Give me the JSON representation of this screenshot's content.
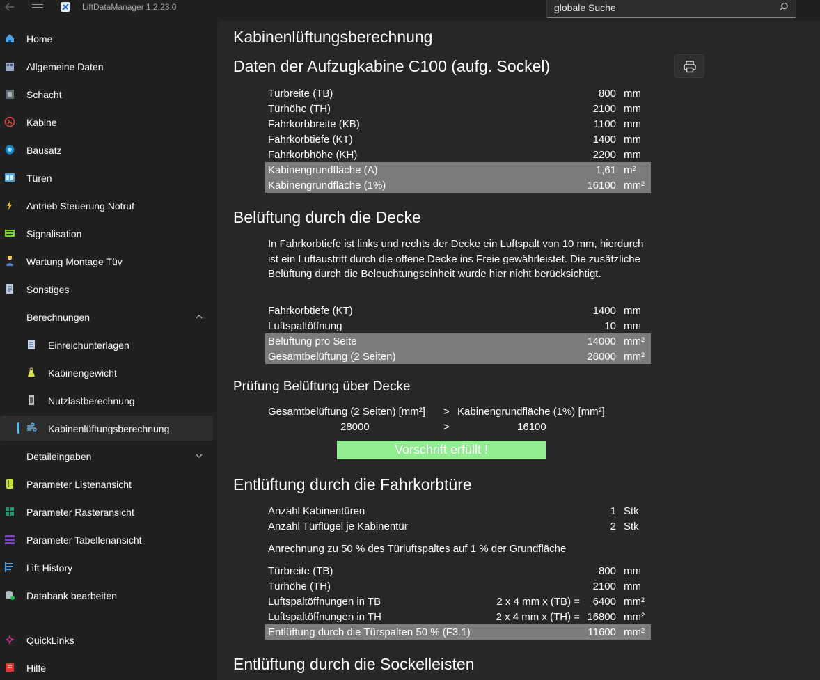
{
  "app": {
    "title": "LiftDataManager  1.2.23.0",
    "search_placeholder": "globale Suche"
  },
  "colors": {
    "accent": "#4cc2ff",
    "highlight_row": "#7c7c7c",
    "success": "#90ee90",
    "content_bg": "#272727",
    "window_bg": "#202020"
  },
  "sidebar": {
    "items": [
      {
        "label": "Home",
        "icon": "home-icon"
      },
      {
        "label": "Allgemeine Daten",
        "icon": "building-icon"
      },
      {
        "label": "Schacht",
        "icon": "shaft-icon"
      },
      {
        "label": "Kabine",
        "icon": "cabin-icon"
      },
      {
        "label": "Bausatz",
        "icon": "kit-icon"
      },
      {
        "label": "Türen",
        "icon": "door-icon"
      },
      {
        "label": "Antrieb Steuerung Notruf",
        "icon": "lightning-icon"
      },
      {
        "label": "Signalisation",
        "icon": "signal-panel-icon"
      },
      {
        "label": "Wartung Montage Tüv",
        "icon": "worker-icon"
      },
      {
        "label": "Sonstiges",
        "icon": "document-icon"
      },
      {
        "label": "Berechnungen",
        "icon": "",
        "expanded": true
      },
      {
        "label": "Einreichunterlagen",
        "icon": "submission-icon",
        "sub": true
      },
      {
        "label": "Kabinengewicht",
        "icon": "weight-icon",
        "sub": true
      },
      {
        "label": "Nutzlastberechnung",
        "icon": "payload-icon",
        "sub": true
      },
      {
        "label": "Kabinenlüftungsberechnung",
        "icon": "ventilation-icon",
        "sub": true,
        "active": true
      },
      {
        "label": "Detaileingaben",
        "icon": "",
        "expanded": false
      },
      {
        "label": "Parameter Listenansicht",
        "icon": "list-view-icon"
      },
      {
        "label": "Parameter Rasteransicht",
        "icon": "grid-view-icon"
      },
      {
        "label": "Parameter Tabellenansicht",
        "icon": "table-view-icon"
      },
      {
        "label": "Lift History",
        "icon": "history-icon"
      },
      {
        "label": "Databank bearbeiten",
        "icon": "database-edit-icon"
      },
      {
        "label": "QuickLinks",
        "icon": "quicklinks-icon"
      },
      {
        "label": "Hilfe",
        "icon": "help-book-icon"
      }
    ]
  },
  "page": {
    "title": "Kabinenlüftungsberechnung",
    "section1": {
      "title": "Daten der Aufzugkabine C100 (aufg. Sockel)",
      "rows": [
        {
          "label": "Türbreite (TB)",
          "value": "800",
          "unit": "mm",
          "highlight": false
        },
        {
          "label": "Türhöhe (TH)",
          "value": "2100",
          "unit": "mm",
          "highlight": false
        },
        {
          "label": "Fahrkorbbreite (KB)",
          "value": "1100",
          "unit": "mm",
          "highlight": false
        },
        {
          "label": "Fahrkorbtiefe (KT)",
          "value": "1400",
          "unit": "mm",
          "highlight": false
        },
        {
          "label": "Fahrkorbhöhe (KH)",
          "value": "2200",
          "unit": "mm",
          "highlight": false
        },
        {
          "label": "Kabinengrundfläche (A)",
          "value": "1,61",
          "unit": " m²",
          "highlight": true
        },
        {
          "label": "Kabinengrundfläche (1%)",
          "value": "16100",
          "unit": "mm²",
          "highlight": true
        }
      ]
    },
    "section2": {
      "title": "Belüftung durch die Decke",
      "paragraph": "In Fahrkorbtiefe ist links und rechts der Decke ein Luftspalt von 10 mm, hierdurch ist ein Luftaustritt durch die offene Decke ins Freie gewährleistet. Die zusätzliche Belüftung durch die Beleuchtungseinheit wurde hier nicht berücksichtigt.",
      "rows": [
        {
          "label": "Fahrkorbtiefe (KT)",
          "value": "1400",
          "unit": "mm",
          "highlight": false
        },
        {
          "label": "Luftspaltöffnung",
          "value": "10",
          "unit": "mm",
          "highlight": false
        },
        {
          "label": "Belüftung pro Seite",
          "value": "14000",
          "unit": "mm²",
          "highlight": true
        },
        {
          "label": "Gesamtbelüftung (2 Seiten)",
          "value": "28000",
          "unit": "mm²",
          "highlight": true
        }
      ]
    },
    "check": {
      "title": "Prüfung Belüftung über Decke",
      "left_label": "Gesamtbelüftung (2 Seiten) [mm²]",
      "operator": ">",
      "right_label": "Kabinengrundfläche (1%) [mm²]",
      "left_value": "28000",
      "right_value": "16100",
      "result": "Vorschrift erfüllt !"
    },
    "section3": {
      "title": "Entlüftung durch die Fahrkorbtüre",
      "rows_a": [
        {
          "label": "Anzahl Kabinentüren",
          "value": "1",
          "unit": "Stk"
        },
        {
          "label": "Anzahl Türflügel je Kabinentür",
          "value": "2",
          "unit": "Stk"
        }
      ],
      "note": "Anrechnung zu 50 % des Türluftspaltes auf 1 % der Grundfläche",
      "rows_b": [
        {
          "label": "Türbreite (TB)",
          "formula": "",
          "value": "800",
          "unit": "mm",
          "highlight": false
        },
        {
          "label": "Türhöhe (TH)",
          "formula": "",
          "value": "2100",
          "unit": "mm",
          "highlight": false
        },
        {
          "label": "Luftspaltöffnungen in TB",
          "formula": "2  x  4 mm x (TB) =",
          "value": "6400",
          "unit": "mm²",
          "highlight": false
        },
        {
          "label": "Luftspaltöffnungen in TH",
          "formula": "2  x  4 mm x (TH) =",
          "value": "16800",
          "unit": "mm²",
          "highlight": false
        },
        {
          "label": "Entlüftung durch die Türspalten 50 % (F3.1)",
          "formula": "",
          "value": "11600",
          "unit": "mm²",
          "highlight": true
        }
      ]
    },
    "section4": {
      "title": "Entlüftung durch die Sockelleisten"
    }
  }
}
